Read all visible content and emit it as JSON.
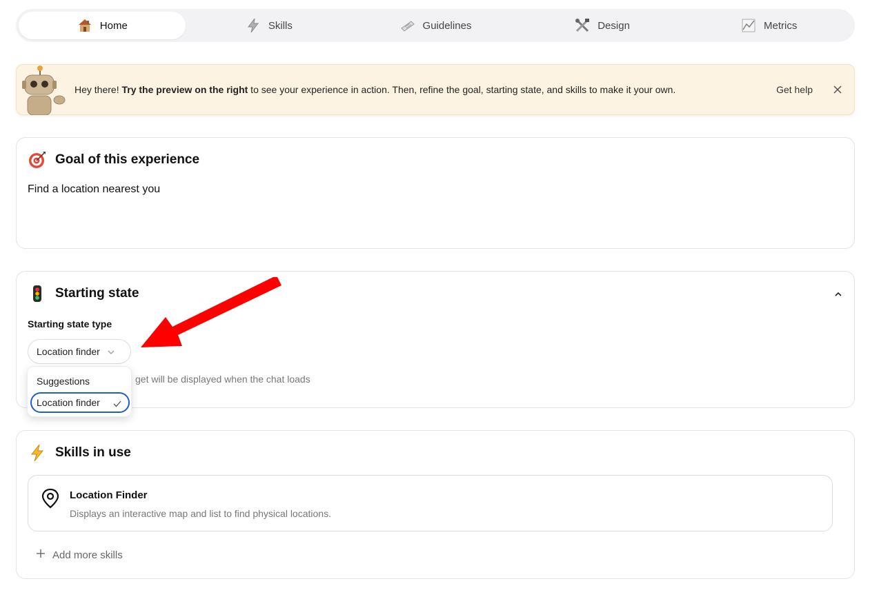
{
  "tabs": [
    {
      "label": "Home",
      "icon": "house-icon",
      "active": true
    },
    {
      "label": "Skills",
      "icon": "lightning-icon",
      "active": false
    },
    {
      "label": "Guidelines",
      "icon": "document-icon",
      "active": false
    },
    {
      "label": "Design",
      "icon": "tools-icon",
      "active": false
    },
    {
      "label": "Metrics",
      "icon": "chart-icon",
      "active": false
    }
  ],
  "banner": {
    "greeting": "Hey there! ",
    "emphasis": "Try the preview on the right",
    "rest": " to see your experience in action. Then, refine the goal, starting state, and skills to make it your own.",
    "help_label": "Get help"
  },
  "goal": {
    "title": "Goal of this experience",
    "value": "Find a location nearest you"
  },
  "starting_state": {
    "title": "Starting state",
    "field_label": "Starting state type",
    "selected": "Location finder",
    "hint": "get will be displayed when the chat loads",
    "options": [
      "Suggestions",
      "Location finder"
    ]
  },
  "skills": {
    "title": "Skills in use",
    "items": [
      {
        "name": "Location Finder",
        "description": "Displays an interactive map and list to find physical locations."
      }
    ],
    "add_label": "Add more skills"
  },
  "colors": {
    "banner_bg": "#fdf3e3",
    "accent_blue": "#1d5fc4",
    "annotation_arrow": "#ff0000"
  }
}
